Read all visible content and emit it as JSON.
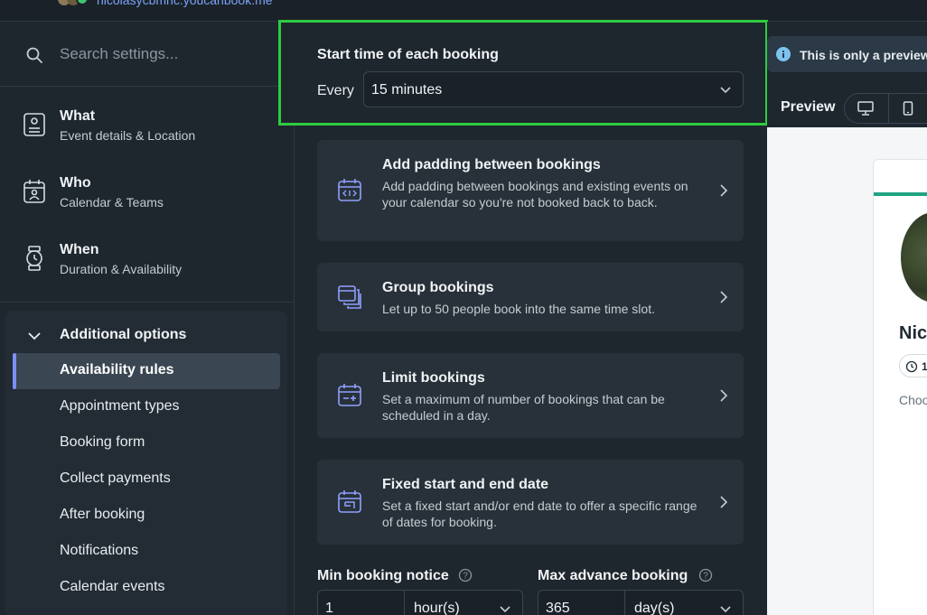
{
  "topbar": {
    "url": "nicolasycbmnc.youcanbook.me"
  },
  "sidebar": {
    "search_placeholder": "Search settings...",
    "nav": [
      {
        "title": "What",
        "subtitle": "Event details & Location",
        "icon": "id-card-icon"
      },
      {
        "title": "Who",
        "subtitle": "Calendar & Teams",
        "icon": "calendar-person-icon"
      },
      {
        "title": "When",
        "subtitle": "Duration & Availability",
        "icon": "watch-icon"
      }
    ],
    "options_header": "Additional options",
    "options": [
      "Availability rules",
      "Appointment types",
      "Booking form",
      "Collect payments",
      "After booking",
      "Notifications",
      "Calendar events"
    ],
    "active_option": "Availability rules"
  },
  "start_time": {
    "heading": "Start time of each booking",
    "prefix": "Every",
    "value": "15 minutes"
  },
  "cards": [
    {
      "title": "Add padding between bookings",
      "desc": "Add padding between bookings and existing events on your calendar so you're not booked back to back.",
      "icon": "padding-calendar-icon"
    },
    {
      "title": "Group bookings",
      "desc": "Let up to 50 people book into the same time slot.",
      "icon": "group-calendar-icon"
    },
    {
      "title": "Limit bookings",
      "desc": "Set a maximum of number of bookings that can be scheduled in a day.",
      "icon": "limit-calendar-icon"
    },
    {
      "title": "Fixed start and end date",
      "desc": "Set a fixed start and/or end date to offer a specific range of dates for booking.",
      "icon": "fixed-date-calendar-icon"
    }
  ],
  "min_notice": {
    "label": "Min booking notice",
    "value": "1",
    "unit": "hour(s)"
  },
  "max_advance": {
    "label": "Max advance booking",
    "value": "365",
    "unit": "day(s)"
  },
  "preview": {
    "notice": "This is only a preview",
    "label": "Preview",
    "name": "Nic",
    "duration": "1",
    "choose": "Choo"
  },
  "colors": {
    "highlight": "#2ecc40",
    "accent": "#7b8ff5",
    "brand_green": "#1fa383"
  }
}
